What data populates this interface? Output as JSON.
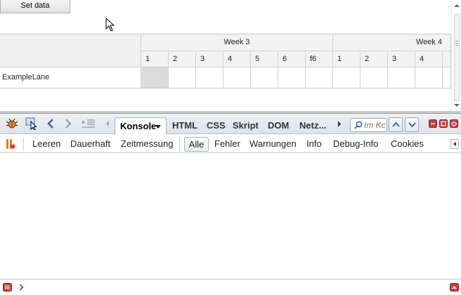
{
  "page": {
    "set_data_label": "Set data",
    "grid": {
      "weeks": [
        "Week 3",
        "Week 4"
      ],
      "days_week3": [
        "1",
        "2",
        "3",
        "4",
        "5",
        "6",
        "f6"
      ],
      "days_week4": [
        "1",
        "2",
        "3",
        "4"
      ],
      "lane_label": "ExampleLane"
    }
  },
  "firebug": {
    "tabs": {
      "console": "Konsole",
      "html": "HTML",
      "css": "CSS",
      "script": "Skript",
      "dom": "DOM",
      "net": "Netz..."
    },
    "search_placeholder": "Im Kc",
    "console_toolbar": {
      "clear": "Leeren",
      "persist": "Dauerhaft",
      "profile": "Zeitmessung",
      "filters": {
        "all": "Alle",
        "errors": "Fehler",
        "warnings": "Warnungen",
        "info": "Info",
        "debug": "Debug-Info",
        "cookies": "Cookies"
      }
    }
  },
  "colors": {
    "toolbar_bg": "#e4e9ef",
    "accent_blue": "#2b63b5",
    "close_red": "#d23a3a"
  }
}
